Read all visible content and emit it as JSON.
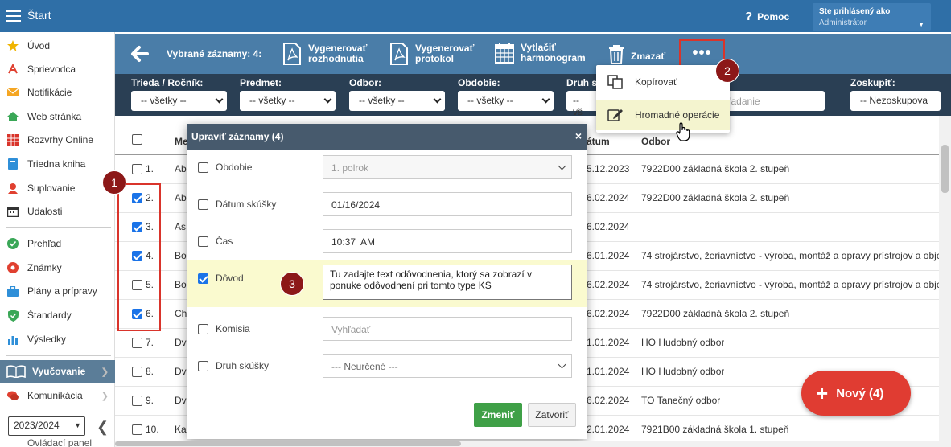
{
  "topbar": {
    "title": "Štart",
    "help": "Pomoc",
    "help_glyph": "?",
    "user_line1": "Ste prihlásený ako",
    "user_line2": "Administrátor"
  },
  "sidebar": {
    "items": [
      {
        "label": "Úvod",
        "icon": "star-icon",
        "color": "#f0b400"
      },
      {
        "label": "Sprievodca",
        "icon": "guide-icon",
        "color": "#e04030"
      },
      {
        "label": "Notifikácie",
        "icon": "envelope-icon",
        "color": "#f5a623"
      },
      {
        "label": "Web stránka",
        "icon": "house-icon",
        "color": "#3aa757"
      },
      {
        "label": "Rozvrhy Online",
        "icon": "calendar-grid-icon",
        "color": "#d9342b"
      },
      {
        "label": "Triedna kniha",
        "icon": "book-icon",
        "color": "#2f8fd8"
      },
      {
        "label": "Suplovanie",
        "icon": "person-icon",
        "color": "#e04030"
      },
      {
        "label": "Udalosti",
        "icon": "calendar-icon",
        "color": "#333333"
      },
      {
        "label": "Prehľad",
        "icon": "check-circle-icon",
        "color": "#3aa757"
      },
      {
        "label": "Známky",
        "icon": "grade-icon",
        "color": "#e04030"
      },
      {
        "label": "Plány a prípravy",
        "icon": "briefcase-icon",
        "color": "#2f8fd8"
      },
      {
        "label": "Štandardy",
        "icon": "shield-check-icon",
        "color": "#3aa757"
      },
      {
        "label": "Výsledky",
        "icon": "chart-icon",
        "color": "#2f8fd8"
      }
    ],
    "section_active": "Vyučovanie",
    "section_next": "Komunikácia",
    "section_cut": "Ovládací panel",
    "year": "2023/2024"
  },
  "actionbar": {
    "selected": "Vybrané záznamy: 4:",
    "btn1": [
      "Vygenerovať",
      "rozhodnutia"
    ],
    "btn2": [
      "Vygenerovať",
      "protokol"
    ],
    "btn3": [
      "Vytlačiť",
      "harmonogram"
    ],
    "btn4": "Zmazať",
    "more": "•••"
  },
  "filters": {
    "trieda_label": "Trieda / Ročník:",
    "trieda_value": "-- všetky --",
    "predmet_label": "Predmet:",
    "predmet_value": "-- všetky --",
    "odbor_label": "Odbor:",
    "odbor_value": "-- všetky --",
    "obdobie_label": "Obdobie:",
    "obdobie_value": "-- všetky --",
    "druh_label": "Druh s",
    "druh_value": "-- vš",
    "search_placeholder": "ľadanie",
    "zoskupit_label": "Zoskupiť:",
    "zoskupit_value": "-- Nezoskupova"
  },
  "table": {
    "headers": {
      "name": "Me",
      "date": "átum",
      "odbor": "Odbor"
    },
    "rows": [
      {
        "num": "1.",
        "name": "Ab",
        "date": "5.12.2023",
        "odbor": "7922D00 základná škola 2. stupeň",
        "checked": false
      },
      {
        "num": "2.",
        "name": "Ab",
        "date": "6.02.2024",
        "odbor": "7922D00 základná škola 2. stupeň",
        "checked": true
      },
      {
        "num": "3.",
        "name": "As",
        "date": "6.02.2024",
        "odbor": "",
        "checked": true
      },
      {
        "num": "4.",
        "name": "Bo",
        "date": "6.01.2024",
        "odbor": "74 strojárstvo, žeriavníctvo - výroba, montáž a opravy prístrojov a obje",
        "checked": true
      },
      {
        "num": "5.",
        "name": "Bo",
        "date": "6.02.2024",
        "odbor": "74 strojárstvo, žeriavníctvo - výroba, montáž a opravy prístrojov a obje",
        "checked": false
      },
      {
        "num": "6.",
        "name": "Ch",
        "date": "6.02.2024",
        "odbor": "7922D00 základná škola 2. stupeň",
        "checked": true
      },
      {
        "num": "7.",
        "name": "Dv",
        "date": "1.01.2024",
        "odbor": "HO Hudobný odbor",
        "checked": false
      },
      {
        "num": "8.",
        "name": "Dv",
        "date": "1.01.2024",
        "odbor": "HO Hudobný odbor",
        "checked": false
      },
      {
        "num": "9.",
        "name": "Dv",
        "date": "6.02.2024",
        "odbor": "TO Tanečný odbor",
        "checked": false
      },
      {
        "num": "10.",
        "name": "Ka",
        "date": "2.01.2024",
        "odbor": "7921B00 základná škola 1. stupeň",
        "checked": false
      }
    ]
  },
  "dropdown": {
    "item1": "Kopírovať",
    "item2": "Hromadné operácie"
  },
  "modal": {
    "title": "Upraviť záznamy (4)",
    "close": "×",
    "obdobie_label": "Obdobie",
    "obdobie_value": "1. polrok",
    "datum_label": "Dátum skúšky",
    "datum_value": "01/16/2024",
    "cas_label": "Čas",
    "cas_value": "10:37  AM",
    "dovod_label": "Dôvod",
    "dovod_value": "Tu zadajte text odôvodnenia, ktorý sa zobrazí v ponuke odôvodnení pri tomto type KS",
    "komisia_label": "Komisia",
    "komisia_placeholder": "Vyhľadať",
    "druh_label": "Druh skúšky",
    "druh_value": "--- Neurčené ---",
    "ok": "Zmeniť",
    "cancel": "Zatvoriť"
  },
  "fab": {
    "plus": "+",
    "label": "Nový (4)"
  },
  "badges": {
    "b1": "1",
    "b2": "2",
    "b3": "3"
  },
  "colors": {
    "accent": "#2f6fa7",
    "filterbar": "#2a3f54",
    "actionbar": "#4a7da8",
    "badge": "#8c1818",
    "fab": "#e03c32",
    "ok": "#3fa047"
  }
}
